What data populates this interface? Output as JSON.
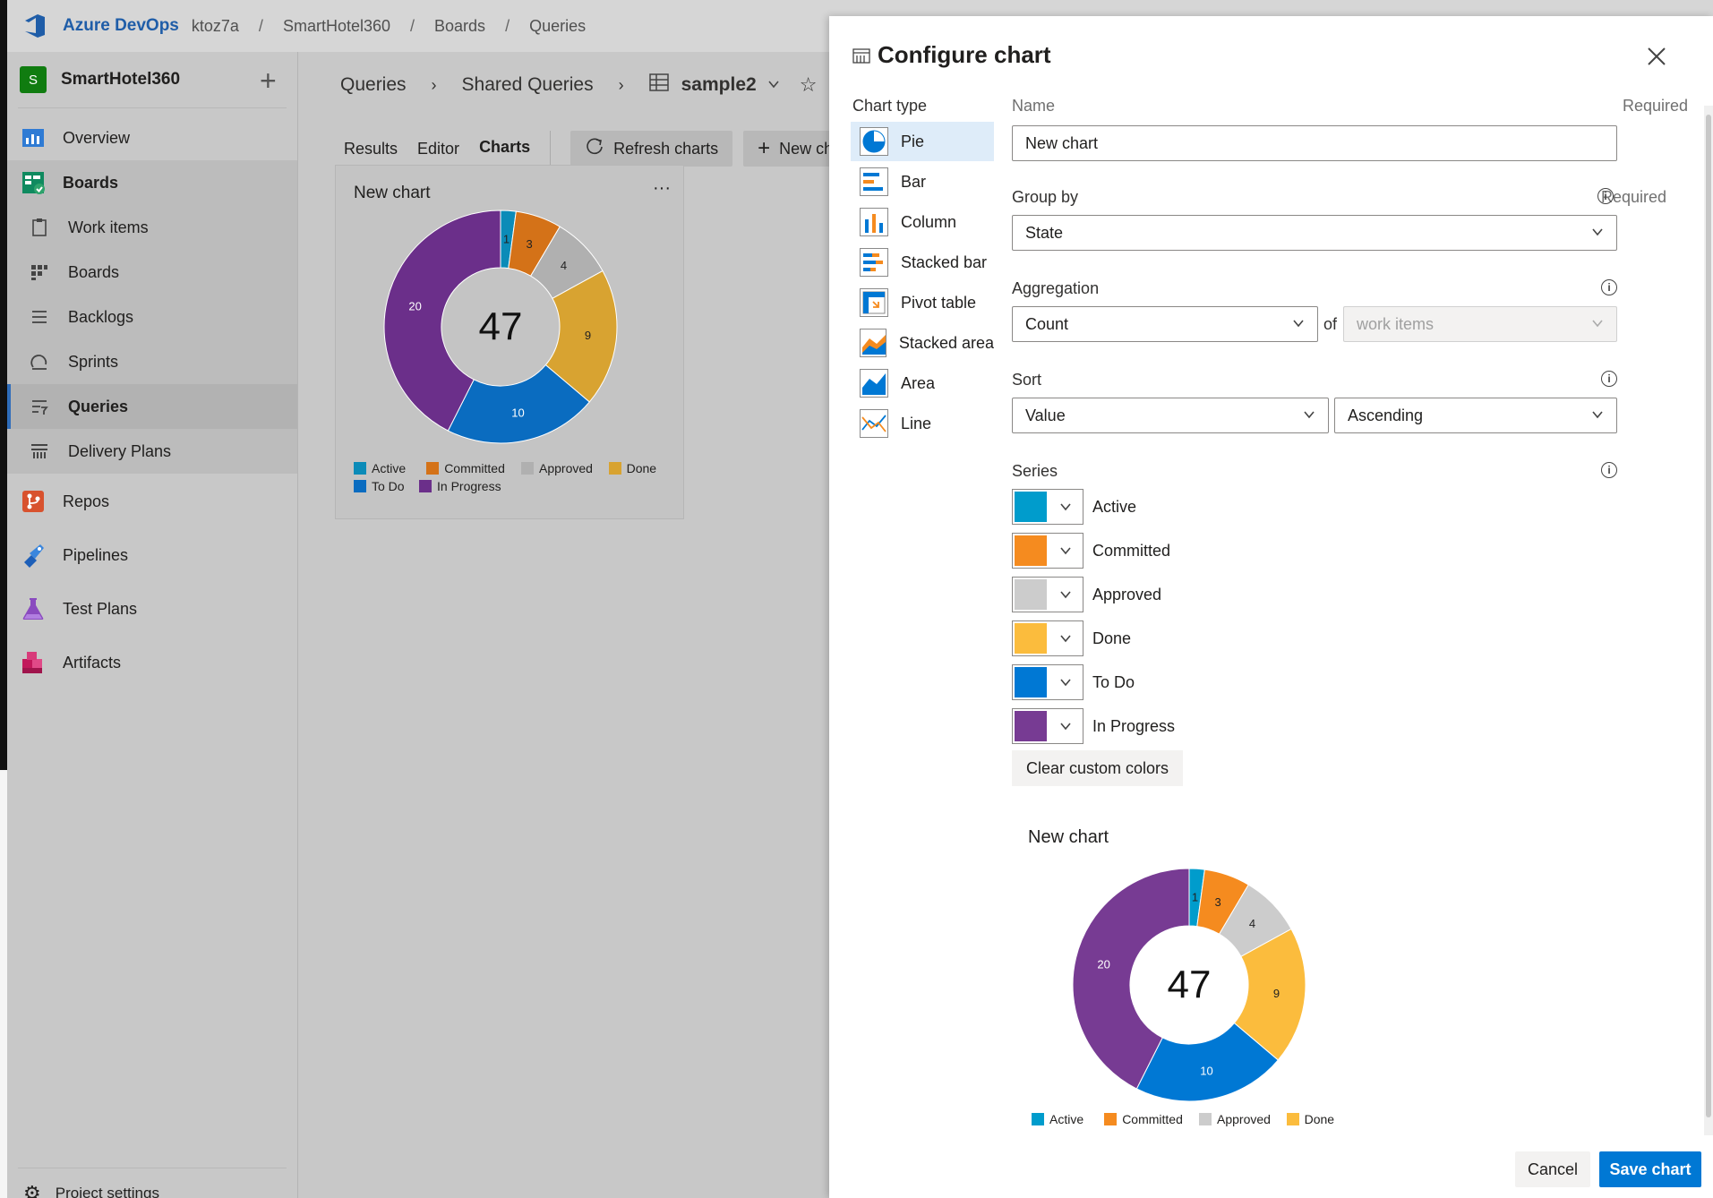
{
  "header": {
    "brand": "Azure DevOps",
    "org": "ktoz7a",
    "project": "SmartHotel360",
    "section": "Boards",
    "page": "Queries",
    "sep": "/"
  },
  "sidebar": {
    "project_initial": "S",
    "project_name": "SmartHotel360",
    "items": [
      {
        "label": "Overview"
      },
      {
        "label": "Boards"
      },
      {
        "label": "Work items"
      },
      {
        "label": "Boards"
      },
      {
        "label": "Backlogs"
      },
      {
        "label": "Sprints"
      },
      {
        "label": "Queries"
      },
      {
        "label": "Delivery Plans"
      },
      {
        "label": "Repos"
      },
      {
        "label": "Pipelines"
      },
      {
        "label": "Test Plans"
      },
      {
        "label": "Artifacts"
      }
    ],
    "settings": "Project settings"
  },
  "main": {
    "breadcrumb": [
      "Queries",
      "Shared Queries",
      "sample2"
    ],
    "tabs": [
      "Results",
      "Editor",
      "Charts"
    ],
    "refresh": "Refresh charts",
    "new_chart": "New ch",
    "card_title": "New chart",
    "card_menu": "···"
  },
  "panel": {
    "title": "Configure chart",
    "chart_type_label": "Chart type",
    "chart_types": [
      "Pie",
      "Bar",
      "Column",
      "Stacked bar",
      "Pivot table",
      "Stacked area",
      "Area",
      "Line"
    ],
    "name_label": "Name",
    "required": "Required",
    "name_value": "New chart",
    "group_by_label": "Group by",
    "group_by_value": "State",
    "aggregation_label": "Aggregation",
    "aggregation_value": "Count",
    "of_label": "of",
    "of_value": "work items",
    "sort_label": "Sort",
    "sort_value": "Value",
    "sort_dir": "Ascending",
    "series_label": "Series",
    "series": [
      {
        "name": "Active",
        "color": "#009ccc"
      },
      {
        "name": "Committed",
        "color": "#f58b1f"
      },
      {
        "name": "Approved",
        "color": "#cccccc"
      },
      {
        "name": "Done",
        "color": "#fbbc3d"
      },
      {
        "name": "To Do",
        "color": "#0078d4"
      },
      {
        "name": "In Progress",
        "color": "#773b93"
      }
    ],
    "clear_colors": "Clear custom colors",
    "preview_title": "New chart",
    "cancel": "Cancel",
    "save": "Save chart"
  },
  "chart_data": {
    "type": "pie",
    "categories": [
      "Active",
      "Committed",
      "Approved",
      "Done",
      "To Do",
      "In Progress"
    ],
    "values": [
      1,
      3,
      4,
      9,
      10,
      20
    ],
    "total": "47",
    "title": "New chart",
    "legend": "bottom"
  }
}
